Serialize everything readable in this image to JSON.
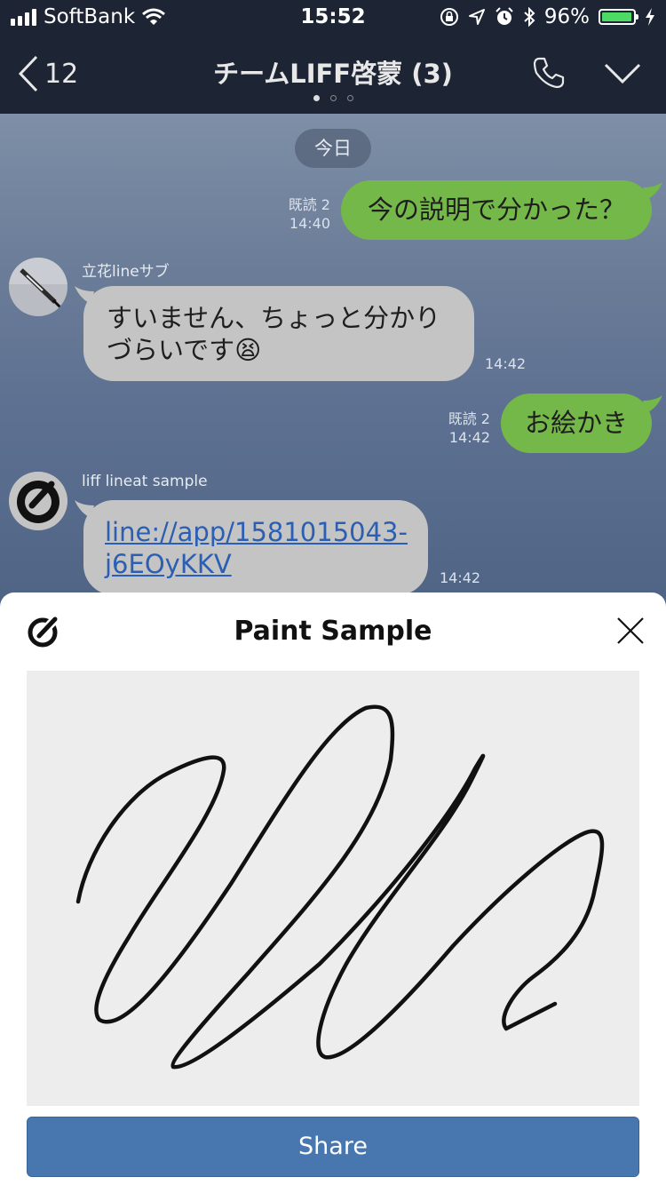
{
  "status_bar": {
    "carrier": "SoftBank",
    "time": "15:52",
    "battery_percent": "96%",
    "battery_level": 0.96,
    "icons": [
      "signal-icon",
      "wifi-icon",
      "orientation-lock-icon",
      "location-icon",
      "alarm-icon",
      "bluetooth-icon",
      "battery-icon",
      "charging-icon"
    ]
  },
  "nav": {
    "back_count": "12",
    "title": "チームLIFF啓蒙 (3)",
    "page_dots": 3,
    "active_dot": 0
  },
  "chat": {
    "date_label": "今日",
    "messages": [
      {
        "side": "right",
        "text": "今の説明で分かった？",
        "read": "既読 2",
        "time": "14:40"
      },
      {
        "side": "left",
        "sender": "立花lineサブ",
        "text_line1": "すいません、ちょっと分かり",
        "text_line2": "づらいです",
        "emoji": "😫",
        "time": "14:42"
      },
      {
        "side": "right",
        "text": "お絵かき",
        "read": "既読 2",
        "time": "14:42"
      },
      {
        "side": "left",
        "sender": "liff lineat sample",
        "link_line1": "line://app/1581015043-",
        "link_line2": "j6EOyKKV",
        "time": "14:42"
      }
    ]
  },
  "sheet": {
    "title": "Paint Sample",
    "share_label": "Share"
  },
  "colors": {
    "header_bg": "#1d2434",
    "my_bubble": "#75b84a",
    "their_bubble": "#c4c4c4",
    "link": "#2b5fb3",
    "share_button": "#4877b0",
    "canvas_bg": "#ededed"
  }
}
